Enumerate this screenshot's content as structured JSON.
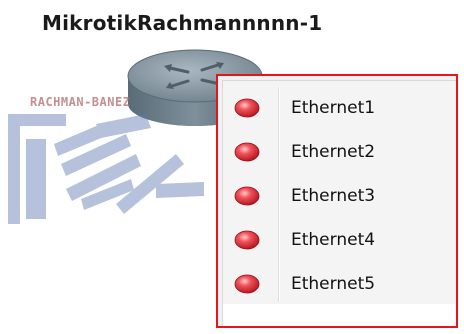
{
  "device": {
    "title": "MikrotikRachmannnnn-1",
    "icon": "router-icon"
  },
  "watermark": {
    "text": "RACHMAN-BANEZ",
    "icon": "rb-logo-watermark"
  },
  "context_menu": {
    "border_color": "#e8141c",
    "items": [
      {
        "label": "Ethernet1",
        "icon": "red-led-icon",
        "status_color": "#e8303a"
      },
      {
        "label": "Ethernet2",
        "icon": "red-led-icon",
        "status_color": "#e8303a"
      },
      {
        "label": "Ethernet3",
        "icon": "red-led-icon",
        "status_color": "#e8303a"
      },
      {
        "label": "Ethernet4",
        "icon": "red-led-icon",
        "status_color": "#e8303a"
      },
      {
        "label": "Ethernet5",
        "icon": "red-led-icon",
        "status_color": "#e8303a"
      }
    ]
  }
}
